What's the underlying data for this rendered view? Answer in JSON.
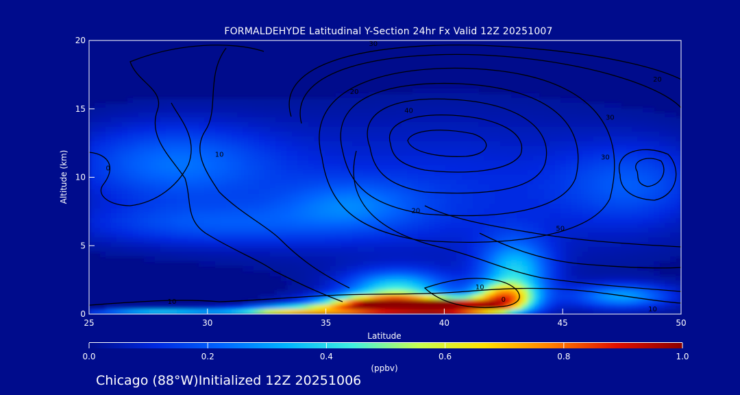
{
  "chart_data": {
    "type": "heatmap",
    "title": "FORMALDEHYDE Latitudinal Y-Section 24hr  Fx Valid 12Z 20251007",
    "xlabel": "Latitude",
    "ylabel": "Altitude (km)",
    "xlim": [
      25,
      50
    ],
    "ylim": [
      0,
      20
    ],
    "x_ticks": [
      "25",
      "30",
      "35",
      "40",
      "45",
      "50"
    ],
    "y_ticks": [
      "0",
      "5",
      "10",
      "15",
      "20"
    ],
    "colorbar": {
      "label": "(ppbv)",
      "range": [
        0.0,
        1.0
      ],
      "ticks": [
        "0.0",
        "0.2",
        "0.4",
        "0.6",
        "0.8",
        "1.0"
      ],
      "colors": [
        "#000c8c",
        "#0028e0",
        "#0064ff",
        "#00b4ff",
        "#40f0e0",
        "#c8ff50",
        "#ffe000",
        "#ff8000",
        "#e01000",
        "#8c0000"
      ]
    },
    "field_blobs": [
      {
        "lat": 37.5,
        "alt": 0.6,
        "value": 1.0,
        "wx": 2.8,
        "wy": 0.7
      },
      {
        "lat": 40.5,
        "alt": 0.5,
        "value": 0.85,
        "wx": 2.0,
        "wy": 0.55
      },
      {
        "lat": 42.5,
        "alt": 1.2,
        "value": 0.6,
        "wx": 1.3,
        "wy": 1.0
      },
      {
        "lat": 33.5,
        "alt": 0.25,
        "value": 0.6,
        "wx": 2.5,
        "wy": 0.3
      },
      {
        "lat": 38.0,
        "alt": 1.8,
        "value": 0.4,
        "wx": 2.2,
        "wy": 1.3
      },
      {
        "lat": 43.0,
        "alt": 3.0,
        "value": 0.35,
        "wx": 1.5,
        "wy": 2.4
      },
      {
        "lat": 47.5,
        "alt": 1.3,
        "value": 0.3,
        "wx": 2.2,
        "wy": 0.9
      },
      {
        "lat": 28.0,
        "alt": 0.15,
        "value": 0.35,
        "wx": 3.0,
        "wy": 0.25
      },
      {
        "lat": 30.0,
        "alt": 6.5,
        "value": 0.15,
        "wx": 6.0,
        "wy": 1.6
      },
      {
        "lat": 28.5,
        "alt": 11.0,
        "value": 0.22,
        "wx": 4.5,
        "wy": 3.0
      },
      {
        "lat": 40.0,
        "alt": 9.0,
        "value": 0.12,
        "wx": 9.0,
        "wy": 5.5
      },
      {
        "lat": 36.0,
        "alt": 8.0,
        "value": 0.15,
        "wx": 3.0,
        "wy": 1.8
      },
      {
        "lat": 48.0,
        "alt": 9.5,
        "value": 0.15,
        "wx": 3.0,
        "wy": 3.0
      }
    ],
    "contour_levels": [
      "0",
      "10",
      "20",
      "30",
      "40",
      "50"
    ],
    "contour_labels": [
      {
        "text": "10",
        "lat": 28.5,
        "alt": 0.75
      },
      {
        "text": "10",
        "lat": 30.5,
        "alt": 11.5
      },
      {
        "text": "10",
        "lat": 41.5,
        "alt": 1.8
      },
      {
        "text": "0",
        "lat": 25.8,
        "alt": 10.5
      },
      {
        "text": "0",
        "lat": 42.5,
        "alt": 0.9
      },
      {
        "text": "10",
        "lat": 48.8,
        "alt": 0.2
      },
      {
        "text": "20",
        "lat": 38.8,
        "alt": 7.4
      },
      {
        "text": "20",
        "lat": 49.0,
        "alt": 17.0
      },
      {
        "text": "20",
        "lat": 36.2,
        "alt": 16.1
      },
      {
        "text": "30",
        "lat": 46.8,
        "alt": 11.3
      },
      {
        "text": "30",
        "lat": 47.0,
        "alt": 14.2
      },
      {
        "text": "30",
        "lat": 37.0,
        "alt": 19.6
      },
      {
        "text": "40",
        "lat": 38.5,
        "alt": 14.7
      },
      {
        "text": "50",
        "lat": 44.9,
        "alt": 6.1
      }
    ]
  },
  "footer": {
    "location": "Chicago (88°W)Initialized 12Z 20251006"
  }
}
